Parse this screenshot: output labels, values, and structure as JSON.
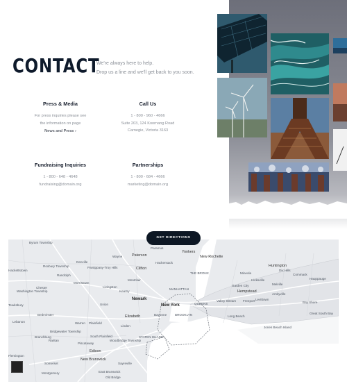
{
  "header": {
    "heading": "CONTACT",
    "tagline_line1": "We're always here to help.",
    "tagline_line2": "Drop us a line and we'll get back to you soon."
  },
  "sections": {
    "press": {
      "title": "Press & Media",
      "line1": "For press inquiries please see",
      "line2": "the information on page",
      "link": "News and Press ›"
    },
    "call": {
      "title": "Call Us",
      "phone": "1 - 800 - 960 - 4666",
      "address1": "Suite 203, 124 Koornang Road",
      "address2": "Carnegie, Victoria 3163"
    },
    "fundraising": {
      "title": "Fundraising Inquiries",
      "phone": "1 - 800 - 648 - 4648",
      "email": "fundraising@domain.org"
    },
    "partnerships": {
      "title": "Partnerships",
      "phone": "1 - 800 - 684 - 4666",
      "email": "marketing@domain.org"
    }
  },
  "map": {
    "button_label": "GET DIRECTIONS",
    "labels": {
      "new_york": "New York",
      "yonkers": "Yonkers",
      "new_rochelle": "New Rochelle",
      "paterson": "Paterson",
      "clifton": "Clifton",
      "newark": "Newark",
      "elizabeth": "Elizabeth",
      "hempstead": "Hempstead",
      "huntington": "Huntington",
      "jones_beach": "Jones Beach Island",
      "edison": "Edison",
      "new_brunswick": "New Brunswick",
      "morristown": "Morristown",
      "plainfield": "Plainfield",
      "union": "Union",
      "hackensack": "Hackensack",
      "paramus": "Paramus",
      "livingston": "Livingston",
      "freeport": "Freeport",
      "long_beach": "Long Beach",
      "montclair": "Montclair",
      "bay_shore": "Bay Shore",
      "hicksville": "Hicksville",
      "somerset": "Somerset",
      "sayreville": "Sayreville",
      "old_bridge": "Old Bridge",
      "woodbridge": "Woodbridge Township",
      "piscataway": "Piscataway",
      "westfield": "Westfield",
      "tewksbury": "Tewksbury",
      "bedminster": "Bedminster",
      "parsippany": "Parsippany-Troy Hills",
      "wayne": "Wayne",
      "denville": "Denville",
      "randolph": "Randolph",
      "chester": "Chester",
      "warren": "Warren",
      "commack": "Commack",
      "hauppauge": "Hauppauge",
      "dix_hills": "Dix Hills",
      "melville": "Melville",
      "levittown": "Levittown",
      "garden_city": "Garden City",
      "valley_stream": "Valley Stream",
      "amityville": "Amityville",
      "mineola": "Mineola",
      "brooklyn": "BROOKLYN",
      "manhattan": "MANHATTAN",
      "queens": "QUEENS",
      "bronx": "THE BRONX",
      "staten_island": "STATEN ISLAND",
      "hackettstown": "Hackettstown",
      "lebanon": "Lebanon",
      "flemington": "Flemington",
      "branchburg": "Branchburg",
      "bridgewater": "Bridgewater Township",
      "raritan": "Raritan",
      "south_plainfield": "South Plainfield",
      "montgomery": "Montgomery",
      "washington": "Washington Township",
      "roxbury": "Roxbury Township",
      "byram": "Byram Township",
      "dover": "Dover",
      "fort_lee": "Fort Lee",
      "great_neck": "Great Neck",
      "massapequa": "Massapequa",
      "great_south_bay": "Great South Bay",
      "kearny": "Kearny",
      "bayonne": "Bayonne",
      "linden": "Linden",
      "rahway": "Rahway",
      "perth_amboy": "Perth Amboy",
      "east_brunswick": "East Brunswick",
      "fanwood": "Fanwood",
      "mount_olive": "Mount Olive Township"
    }
  },
  "colors": {
    "heading": "#0e1a2b",
    "button_bg": "#0d1724",
    "muted_text": "#8a8f97",
    "map_land": "#e9ebee",
    "map_water": "#ffffff"
  }
}
